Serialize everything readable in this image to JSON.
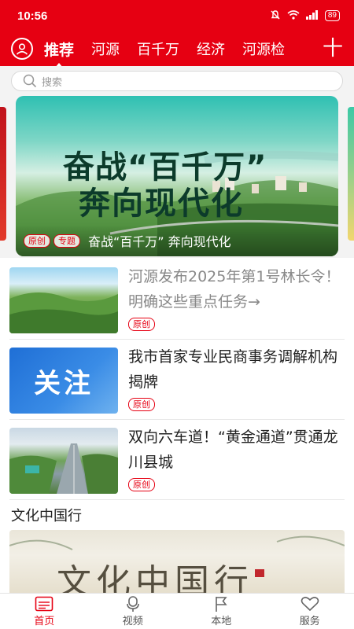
{
  "status_bar": {
    "time": "10:56",
    "battery": "89",
    "icons": [
      "mute-icon",
      "wifi-icon",
      "signal-icon",
      "battery-icon"
    ]
  },
  "nav": {
    "tabs": [
      {
        "label": "推荐",
        "active": true
      },
      {
        "label": "河源",
        "active": false
      },
      {
        "label": "百千万",
        "active": false
      },
      {
        "label": "经济",
        "active": false
      },
      {
        "label": "河源检",
        "active": false
      }
    ],
    "plus_label": "十"
  },
  "search": {
    "placeholder": "搜索"
  },
  "banner": {
    "title_line1": "奋战“百千万”",
    "title_line2": "奔向现代化",
    "tags": [
      "原创",
      "专题"
    ],
    "caption": "奋战“百千万” 奔向现代化"
  },
  "news": [
    {
      "title": "河源发布2025年第1号林长令！明确这些重点任务→",
      "tag": "原创",
      "read": true
    },
    {
      "title": "我市首家专业民商事务调解机构揭牌",
      "tag": "原创",
      "read": false,
      "thumb_text": "关注"
    },
    {
      "title": "双向六车道！“黄金通道”贯通龙川县城",
      "tag": "原创",
      "read": false
    }
  ],
  "section": {
    "title": "文化中国行",
    "image_lettering": "文化中国行"
  },
  "bottom_nav": [
    {
      "label": "首页",
      "icon": "news-icon",
      "active": true
    },
    {
      "label": "视频",
      "icon": "microphone-icon",
      "active": false
    },
    {
      "label": "本地",
      "icon": "flag-icon",
      "active": false
    },
    {
      "label": "服务",
      "icon": "heart-icon",
      "active": false
    }
  ],
  "colors": {
    "brand_red": "#e60012",
    "text_dark": "#222222",
    "text_read": "#888888"
  }
}
